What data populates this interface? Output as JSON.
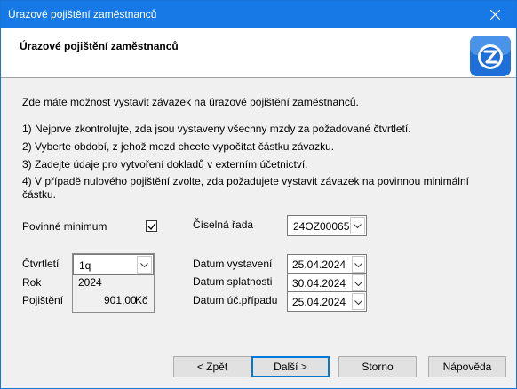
{
  "window": {
    "title": "Úrazové pojištění zaměstnanců"
  },
  "header": {
    "heading": "Úrazové pojištění zaměstnanců"
  },
  "intro": "Zde máte možnost vystavit závazek na úrazové pojištění zaměstnanců.",
  "steps": [
    "1) Nejprve zkontrolujte, zda jsou vystaveny všechny mzdy za požadované čtvrtletí.",
    "2) Vyberte období, z jehož mezd chcete vypočítat částku závazku.",
    "3) Zadejte údaje pro vytvoření dokladů v externím účetnictví.",
    "4) V případě nulového pojištění zvolte, zda požadujete vystavit závazek na povinnou minimální částku."
  ],
  "form": {
    "povinne_minimum_label": "Povinné minimum",
    "povinne_minimum_checked": true,
    "ciselna_rada_label": "Číselná řada",
    "ciselna_rada_value": "24OZ00065",
    "ctvrtleti_label": "Čtvrtletí",
    "ctvrtleti_value": "1q",
    "rok_label": "Rok",
    "rok_value": "2024",
    "pojisteni_label": "Pojištění",
    "pojisteni_value": "901,00",
    "pojisteni_currency": "Kč",
    "datum_vystaveni_label": "Datum vystavení",
    "datum_vystaveni_value": "25.04.2024",
    "datum_splatnosti_label": "Datum splatnosti",
    "datum_splatnosti_value": "30.04.2024",
    "datum_ucpripadu_label": "Datum úč.případu",
    "datum_ucpripadu_value": "25.04.2024"
  },
  "buttons": {
    "back": "< Zpět",
    "next": "Další >",
    "cancel": "Storno",
    "help": "Nápověda"
  },
  "colors": {
    "titlebar": "#1779e6",
    "logo": "#1e6fd9"
  }
}
